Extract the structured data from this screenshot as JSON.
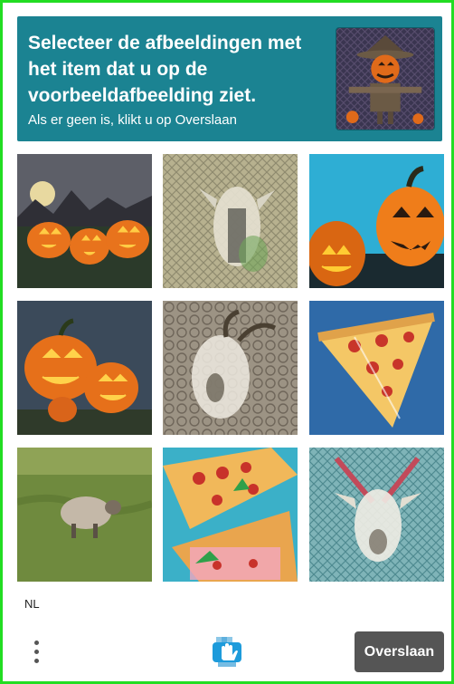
{
  "prompt": {
    "title": "Selecteer de afbeeldingen met het item dat u op de voorbeeldafbeelding ziet.",
    "subtitle": "Als er geen is, klikt u op Overslaan",
    "example_icon": "scarecrow-pumpkin-icon"
  },
  "grid": {
    "tiles": [
      {
        "icon": "pumpkins-moon-icon"
      },
      {
        "icon": "goat-icon"
      },
      {
        "icon": "pumpkins-icon"
      },
      {
        "icon": "pumpkins-icon"
      },
      {
        "icon": "goat-icon"
      },
      {
        "icon": "pizza-icon"
      },
      {
        "icon": "sheep-icon"
      },
      {
        "icon": "pizza-icon"
      },
      {
        "icon": "goat-icon"
      }
    ]
  },
  "footer": {
    "language": "NL",
    "skip_label": "Overslaan",
    "logo_icon": "hcaptcha-hand-icon"
  },
  "colors": {
    "header_bg": "#1b8392",
    "button_bg": "#555555",
    "frame_border": "#22dd22"
  }
}
